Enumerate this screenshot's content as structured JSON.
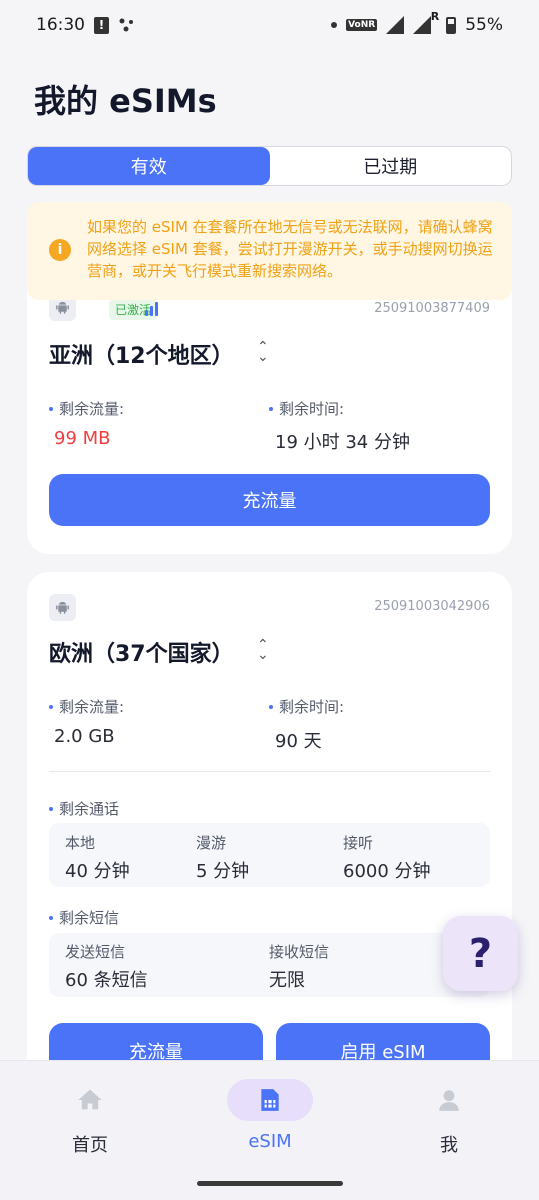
{
  "status_bar": {
    "time": "16:30",
    "network": "VoNR",
    "roaming": "R",
    "battery": "55%"
  },
  "page": {
    "title": "我的 eSIMs"
  },
  "tabs": [
    {
      "label": "有效",
      "active": true
    },
    {
      "label": "已过期",
      "active": false
    }
  ],
  "notice": {
    "icon": "info-icon",
    "text": "如果您的 eSIM 在套餐所在地无信号或无法联网，请确认蜂窝网络选择 eSIM 套餐，尝试打开漫游开关，或手动搜网切换运营商，或开关飞行模式重新搜索网络。"
  },
  "cards": [
    {
      "status_badge": "已激活",
      "order_id": "25091003877409",
      "plan_name": "亚洲（12个地区）",
      "data_label": "剩余流量:",
      "data_value": "99 MB",
      "time_label": "剩余时间:",
      "time_value": "19 小时 34 分钟",
      "button": "充流量"
    },
    {
      "order_id": "25091003042906",
      "plan_name": "欧洲（37个国家）",
      "data_label": "剩余流量:",
      "data_value": "2.0 GB",
      "time_label": "剩余时间:",
      "time_value": "90 天",
      "calls": {
        "title": "剩余通话",
        "cols": [
          {
            "label": "本地",
            "value": "40 分钟"
          },
          {
            "label": "漫游",
            "value": "5 分钟"
          },
          {
            "label": "接听",
            "value": "6000 分钟"
          }
        ]
      },
      "sms": {
        "title": "剩余短信",
        "cols": [
          {
            "label": "发送短信",
            "value": "60 条短信"
          },
          {
            "label": "接收短信",
            "value": "无限"
          }
        ]
      },
      "buttons": [
        "充流量",
        "启用 eSIM"
      ]
    }
  ],
  "help": {
    "label": "?"
  },
  "nav": [
    {
      "label": "首页",
      "icon": "home-icon",
      "active": false
    },
    {
      "label": "eSIM",
      "icon": "sim-card-icon",
      "active": true
    },
    {
      "label": "我",
      "icon": "person-icon",
      "active": false
    }
  ]
}
